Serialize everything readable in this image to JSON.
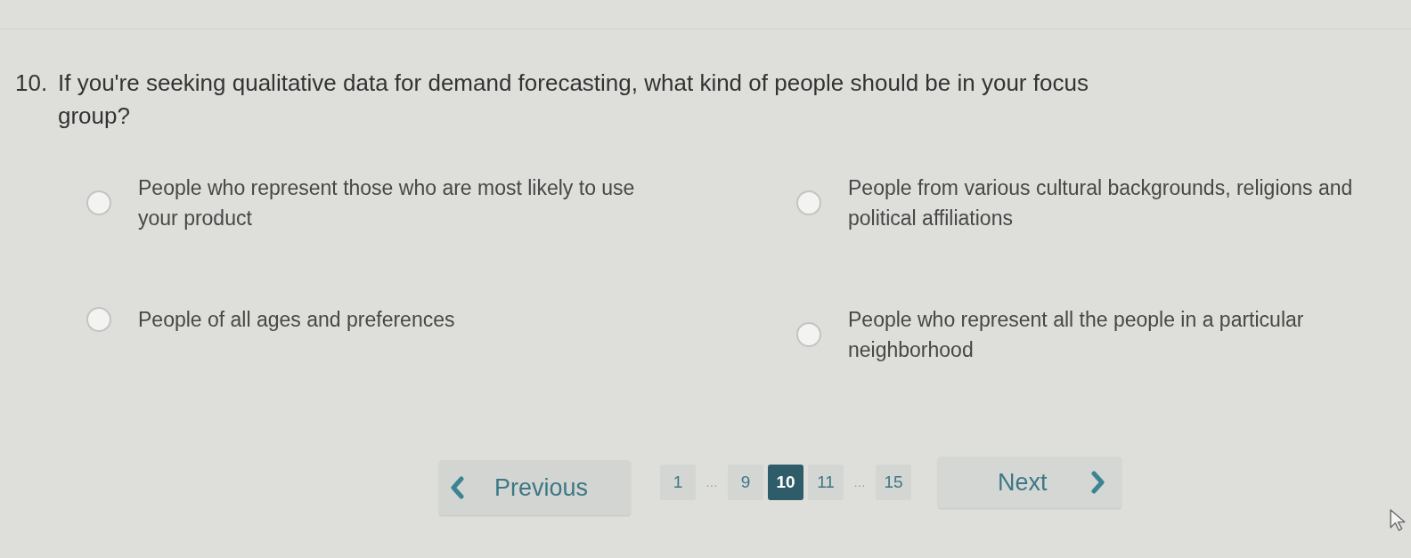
{
  "question": {
    "number": "10.",
    "text": "If you're seeking qualitative data for demand forecasting, what kind of people should be in your focus group?"
  },
  "options": [
    {
      "label": "People who represent those who are most likely to use your product",
      "selected": false
    },
    {
      "label": "People from various cultural backgrounds, religions and political affiliations",
      "selected": false
    },
    {
      "label": "People of all ages and preferences",
      "selected": false
    },
    {
      "label": "People who represent all the people in a particular neighborhood",
      "selected": false
    }
  ],
  "pagination": {
    "previous": "Previous",
    "next": "Next",
    "pages": [
      {
        "kind": "page",
        "label": "1",
        "selected": false
      },
      {
        "kind": "ellipsis",
        "label": "…",
        "selected": false
      },
      {
        "kind": "page",
        "label": "9",
        "selected": false
      },
      {
        "kind": "page",
        "label": "10",
        "selected": true
      },
      {
        "kind": "page",
        "label": "11",
        "selected": false
      },
      {
        "kind": "ellipsis",
        "label": "…",
        "selected": false
      },
      {
        "kind": "page",
        "label": "15",
        "selected": false
      }
    ]
  }
}
